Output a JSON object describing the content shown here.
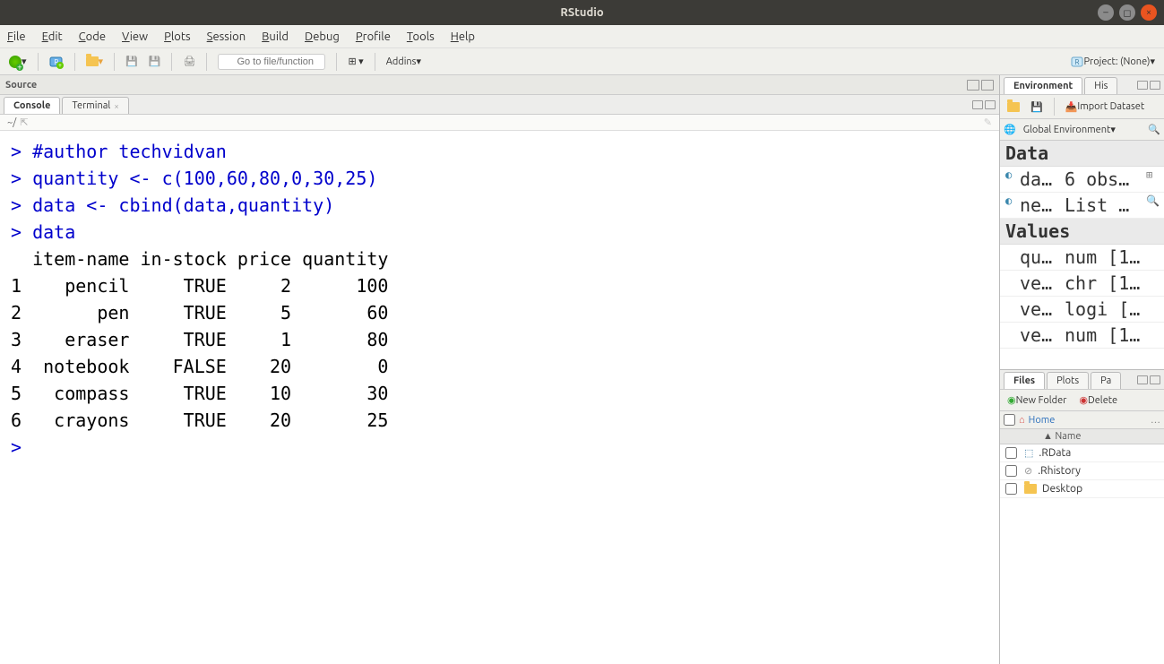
{
  "window": {
    "title": "RStudio"
  },
  "menu": {
    "file": "File",
    "edit": "Edit",
    "code": "Code",
    "view": "View",
    "plots": "Plots",
    "session": "Session",
    "build": "Build",
    "debug": "Debug",
    "profile": "Profile",
    "tools": "Tools",
    "help": "Help"
  },
  "toolbar": {
    "goto_placeholder": "Go to file/function",
    "addins": "Addins",
    "project": "Project: (None)"
  },
  "source": {
    "title": "Source"
  },
  "console": {
    "tabs": {
      "console": "Console",
      "terminal": "Terminal"
    },
    "path": "~/",
    "lines": [
      {
        "t": "cmd",
        "text": "> #author techvidvan"
      },
      {
        "t": "cmd",
        "text": "> quantity <- c(100,60,80,0,30,25)"
      },
      {
        "t": "cmd",
        "text": "> data <- cbind(data,quantity)"
      },
      {
        "t": "cmd",
        "text": "> data"
      },
      {
        "t": "out",
        "text": "  item-name in-stock price quantity"
      },
      {
        "t": "out",
        "text": "1    pencil     TRUE     2      100"
      },
      {
        "t": "out",
        "text": "2       pen     TRUE     5       60"
      },
      {
        "t": "out",
        "text": "3    eraser     TRUE     1       80"
      },
      {
        "t": "out",
        "text": "4  notebook    FALSE    20        0"
      },
      {
        "t": "out",
        "text": "5   compass     TRUE    10       30"
      },
      {
        "t": "out",
        "text": "6   crayons     TRUE    20       25"
      },
      {
        "t": "cmd",
        "text": "> "
      }
    ]
  },
  "env": {
    "tabs": {
      "env": "Environment",
      "hist": "His"
    },
    "import": "Import Dataset",
    "scope": "Global Environment",
    "sections": {
      "data": "Data",
      "values": "Values"
    },
    "data_rows": [
      {
        "name": "da…",
        "val": "6 obs…",
        "grid": true,
        "expand": true
      },
      {
        "name": "ne…",
        "val": "List …",
        "search": true,
        "expand": true
      }
    ],
    "value_rows": [
      {
        "name": "qu…",
        "val": "num [1…"
      },
      {
        "name": "ve…",
        "val": "chr [1…"
      },
      {
        "name": "ve…",
        "val": "logi […"
      },
      {
        "name": "ve…",
        "val": "num [1…"
      }
    ]
  },
  "files": {
    "tabs": {
      "files": "Files",
      "plots": "Plots",
      "pkg": "Pa"
    },
    "new_folder": "New Folder",
    "delete": "Delete",
    "home": "Home",
    "name_col": "Name",
    "rows": [
      {
        "name": ".RData",
        "icon": "rdata"
      },
      {
        "name": ".Rhistory",
        "icon": "rhist"
      },
      {
        "name": "Desktop",
        "icon": "folder"
      }
    ]
  }
}
